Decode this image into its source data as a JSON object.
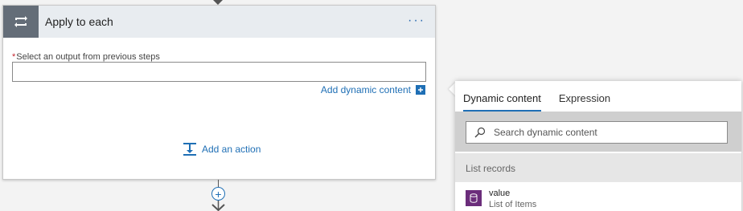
{
  "action_card": {
    "title": "Apply to each",
    "more_label": "···",
    "required_marker": "*",
    "field_label": "Select an output from previous steps",
    "field_value": "",
    "add_dynamic_label": "Add dynamic content",
    "add_action_label": "Add an action",
    "header_color": "#e8ecf0",
    "icon_color": "#646d78"
  },
  "connector": {
    "plus_label": "+"
  },
  "dynamic_panel": {
    "tabs": [
      {
        "label": "Dynamic content",
        "active": true
      },
      {
        "label": "Expression",
        "active": false
      }
    ],
    "search_placeholder": "Search dynamic content",
    "section_title": "List records",
    "items": [
      {
        "name": "value",
        "description": "List of Items",
        "icon": "database-icon",
        "icon_color": "#6b2d7b"
      }
    ]
  },
  "colors": {
    "accent": "#1f6fb5",
    "required": "#c4262e"
  }
}
